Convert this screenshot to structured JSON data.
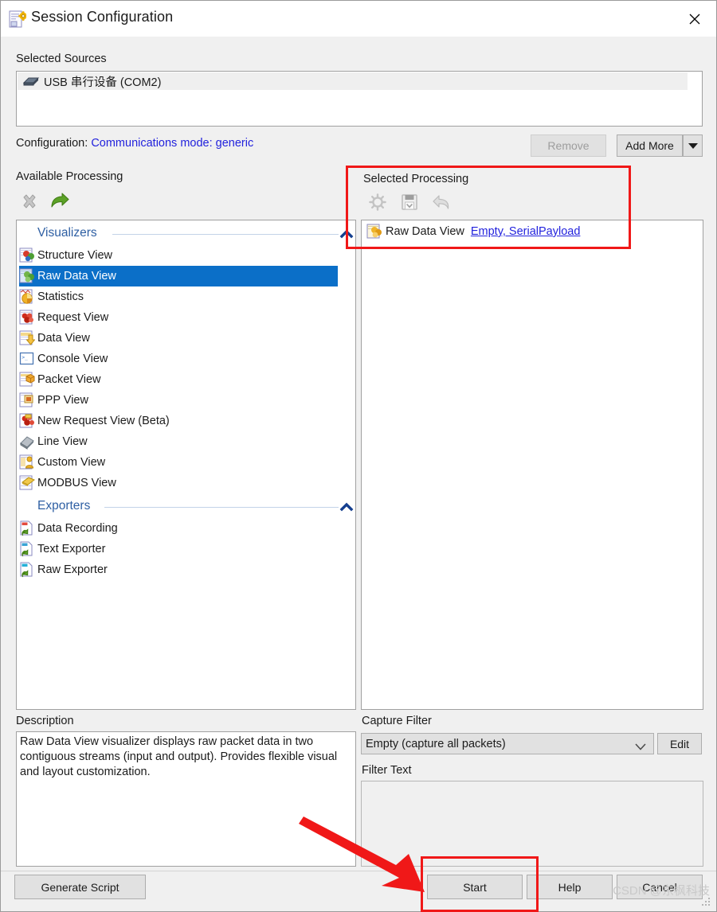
{
  "window": {
    "title": "Session Configuration",
    "icon": "session-config-icon",
    "close_icon": "close-icon"
  },
  "sources": {
    "label": "Selected Sources",
    "items": [
      {
        "icon": "serial-device-icon",
        "name": "USB 串行设备 (COM2)"
      }
    ],
    "configuration_label": "Configuration:",
    "configuration_value": "Communications mode: generic",
    "remove_label": "Remove",
    "add_more_label": "Add More",
    "dropdown_icon": "caret-down-icon"
  },
  "available": {
    "label": "Available Processing",
    "toolbar": [
      {
        "name": "remove-processing-icon",
        "icon": "x-icon",
        "enabled": false
      },
      {
        "name": "add-processing-icon",
        "icon": "green-arrow-right-icon",
        "enabled": true
      }
    ],
    "groups": [
      {
        "name": "Visualizers",
        "collapse_icon": "chevron-up-icon",
        "items": [
          {
            "label": "Structure View",
            "icon": "structure-view-icon",
            "selected": false
          },
          {
            "label": "Raw Data View",
            "icon": "raw-data-view-icon",
            "selected": true
          },
          {
            "label": "Statistics",
            "icon": "statistics-icon",
            "selected": false
          },
          {
            "label": "Request View",
            "icon": "request-view-icon",
            "selected": false
          },
          {
            "label": "Data View",
            "icon": "data-view-icon",
            "selected": false
          },
          {
            "label": "Console View",
            "icon": "console-view-icon",
            "selected": false
          },
          {
            "label": "Packet View",
            "icon": "packet-view-icon",
            "selected": false
          },
          {
            "label": "PPP View",
            "icon": "ppp-view-icon",
            "selected": false
          },
          {
            "label": "New Request View (Beta)",
            "icon": "new-request-view-icon",
            "selected": false
          },
          {
            "label": "Line View",
            "icon": "line-view-icon",
            "selected": false
          },
          {
            "label": "Custom View",
            "icon": "custom-view-icon",
            "selected": false
          },
          {
            "label": "MODBUS View",
            "icon": "modbus-view-icon",
            "selected": false
          }
        ]
      },
      {
        "name": "Exporters",
        "collapse_icon": "chevron-up-icon",
        "items": [
          {
            "label": "Data Recording",
            "icon": "data-recording-icon",
            "selected": false
          },
          {
            "label": "Text Exporter",
            "icon": "text-exporter-icon",
            "selected": false
          },
          {
            "label": "Raw Exporter",
            "icon": "raw-exporter-icon",
            "selected": false
          }
        ]
      }
    ]
  },
  "selected_processing": {
    "label": "Selected Processing",
    "toolbar": [
      {
        "name": "configure-icon",
        "icon": "gear-icon",
        "enabled": false
      },
      {
        "name": "save-icon",
        "icon": "floppy-disk-icon",
        "enabled": false
      },
      {
        "name": "undo-icon",
        "icon": "undo-arrow-icon",
        "enabled": false
      }
    ],
    "items": [
      {
        "icon": "raw-data-view-icon",
        "label": "Raw Data View",
        "link": "Empty, SerialPayload"
      }
    ]
  },
  "description": {
    "label": "Description",
    "text": "Raw Data View visualizer displays raw packet data in two contiguous streams (input and output). Provides flexible visual and layout customization."
  },
  "capture_filter": {
    "label": "Capture Filter",
    "value": "Empty (capture all packets)",
    "dropdown_icon": "chevron-down-icon",
    "edit_label": "Edit",
    "filter_text_label": "Filter Text",
    "filter_text_value": ""
  },
  "footer": {
    "generate_script_label": "Generate Script",
    "start_label": "Start",
    "help_label": "Help",
    "cancel_label": "Cancel"
  },
  "watermark": "CSDN @东枫科技",
  "colors": {
    "accent_blue": "#0b6fc8",
    "link_blue": "#2222dd",
    "group_header_blue": "#2e5fa3",
    "annotation_red": "#f01818",
    "dialog_bg": "#f0f0f0"
  }
}
